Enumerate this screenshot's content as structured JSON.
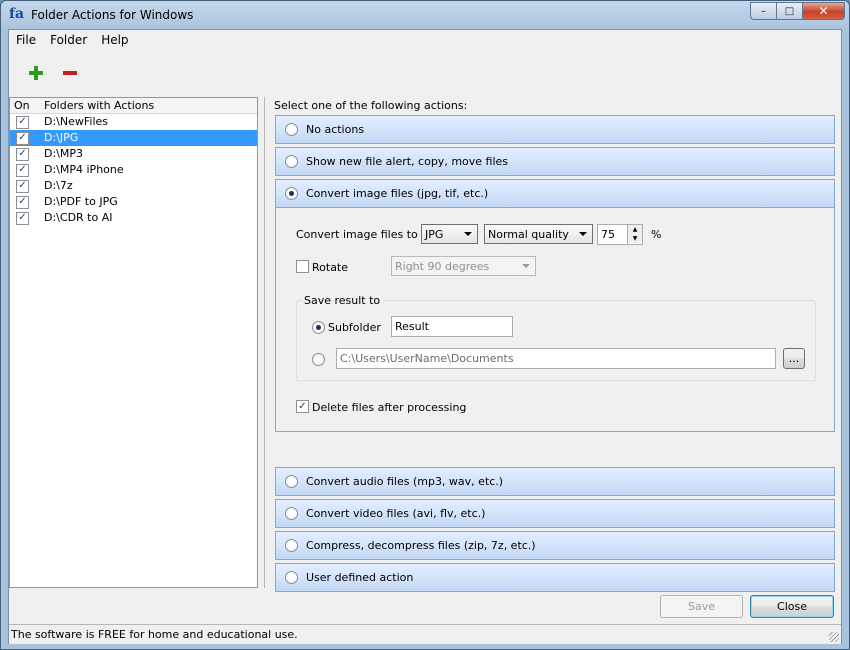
{
  "window": {
    "title": "Folder Actions for Windows",
    "app_icon_text": "fa"
  },
  "caption": {
    "minimize": "–",
    "maximize": "□",
    "close": "✕"
  },
  "menu": [
    "File",
    "Folder",
    "Help"
  ],
  "toolbar": {
    "add_icon": "plus-icon",
    "remove_icon": "minus-icon"
  },
  "folders": {
    "col_on": "On",
    "col_name": "Folders with Actions",
    "items": [
      {
        "path": "D:\\NewFiles",
        "checked": true
      },
      {
        "path": "D:\\JPG",
        "checked": true,
        "selected": true
      },
      {
        "path": "D:\\MP3",
        "checked": true
      },
      {
        "path": "D:\\MP4 iPhone",
        "checked": true
      },
      {
        "path": "D:\\7z",
        "checked": true
      },
      {
        "path": "D:\\PDF to JPG",
        "checked": true
      },
      {
        "path": "D:\\CDR to AI",
        "checked": true
      }
    ]
  },
  "actions": {
    "prompt": "Select one of the following actions:",
    "no_actions": "No actions",
    "show_alert": "Show new file alert, copy, move files",
    "convert_image": "Convert image files (jpg, tif, etc.)",
    "convert_audio": "Convert audio files (mp3, wav, etc.)",
    "convert_video": "Convert video files (avi, flv, etc.)",
    "compress": "Compress, decompress files (zip, 7z, etc.)",
    "user_defined": "User defined action",
    "selected": "convert_image"
  },
  "image_options": {
    "convert_label": "Convert image files to",
    "format": "JPG",
    "quality": "Normal quality",
    "quality_value": "75",
    "percent": "%",
    "rotate_label": "Rotate",
    "rotate_checked": false,
    "rotate_value": "Right 90 degrees",
    "save_result_title": "Save result to",
    "subfolder_label": "Subfolder",
    "subfolder_value": "Result",
    "path_value": "C:\\Users\\UserName\\Documents",
    "browse_label": "...",
    "delete_label": "Delete files after processing",
    "delete_checked": true
  },
  "buttons": {
    "save": "Save",
    "close": "Close"
  },
  "status": "The software is FREE for home and educational use."
}
